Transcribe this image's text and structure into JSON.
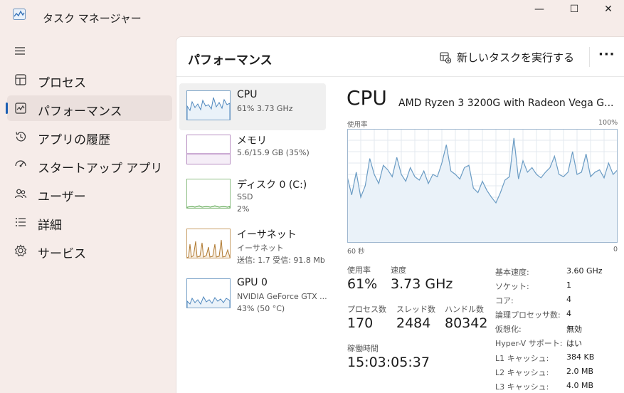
{
  "window": {
    "title": "タスク マネージャー",
    "controls": {
      "minimize": "—",
      "maximize": "☐",
      "close": "✕"
    }
  },
  "nav": {
    "items": [
      {
        "label": "プロセス",
        "icon": "processes-icon"
      },
      {
        "label": "パフォーマンス",
        "icon": "performance-icon",
        "active": true
      },
      {
        "label": "アプリの履歴",
        "icon": "history-icon"
      },
      {
        "label": "スタートアップ アプリ",
        "icon": "startup-icon"
      },
      {
        "label": "ユーザー",
        "icon": "users-icon"
      },
      {
        "label": "詳細",
        "icon": "details-icon"
      },
      {
        "label": "サービス",
        "icon": "services-icon"
      }
    ]
  },
  "header": {
    "title": "パフォーマンス",
    "run_task": "新しいタスクを実行する",
    "more": "···"
  },
  "devices": [
    {
      "name": "CPU",
      "line1": "61%  3.73 GHz",
      "line2": ""
    },
    {
      "name": "メモリ",
      "line1": "5.6/15.9 GB (35%)",
      "line2": ""
    },
    {
      "name": "ディスク 0 (C:)",
      "line1": "SSD",
      "line2": "2%"
    },
    {
      "name": "イーサネット",
      "line1": "イーサネット",
      "line2": "送信: 1.7  受信: 91.8 Mb"
    },
    {
      "name": "GPU 0",
      "line1": "NVIDIA GeForce GTX ...",
      "line2": "43% (50 °C)"
    }
  ],
  "detail": {
    "title": "CPU",
    "model": "AMD Ryzen 3 3200G with Radeon Vega G...",
    "graph_label": "使用率",
    "graph_max": "100%",
    "graph_time_left": "60 秒",
    "graph_time_right": "0",
    "stats": {
      "usage_label": "使用率",
      "usage_value": "61%",
      "speed_label": "速度",
      "speed_value": "3.73 GHz",
      "processes_label": "プロセス数",
      "processes_value": "170",
      "threads_label": "スレッド数",
      "threads_value": "2484",
      "handles_label": "ハンドル数",
      "handles_value": "80342",
      "uptime_label": "稼働時間",
      "uptime_value": "15:03:05:37"
    },
    "specs": [
      {
        "key": "基本速度:",
        "value": "3.60 GHz"
      },
      {
        "key": "ソケット:",
        "value": "1"
      },
      {
        "key": "コア:",
        "value": "4"
      },
      {
        "key": "論理プロセッサ数:",
        "value": "4"
      },
      {
        "key": "仮想化:",
        "value": "無効"
      },
      {
        "key": "Hyper-V サポート:",
        "value": "はい"
      },
      {
        "key": "L1 キャッシュ:",
        "value": "384 KB"
      },
      {
        "key": "L2 キャッシュ:",
        "value": "2.0 MB"
      },
      {
        "key": "L3 キャッシュ:",
        "value": "4.0 MB"
      }
    ]
  },
  "chart_data": {
    "type": "area",
    "ylim": [
      0,
      100
    ],
    "values": [
      58,
      42,
      62,
      40,
      50,
      74,
      60,
      52,
      68,
      64,
      58,
      75,
      60,
      54,
      66,
      58,
      55,
      63,
      52,
      60,
      58,
      70,
      86,
      63,
      60,
      56,
      66,
      68,
      48,
      44,
      54,
      46,
      40,
      35,
      44,
      55,
      58,
      92,
      56,
      72,
      62,
      66,
      60,
      57,
      62,
      66,
      76,
      60,
      58,
      62,
      80,
      60,
      62,
      78,
      58,
      62,
      64,
      57,
      70,
      60,
      64
    ],
    "colors": {
      "line": "#6b9cc4",
      "fill": "#eaf2f9",
      "grid": "#e3e9ef"
    }
  }
}
